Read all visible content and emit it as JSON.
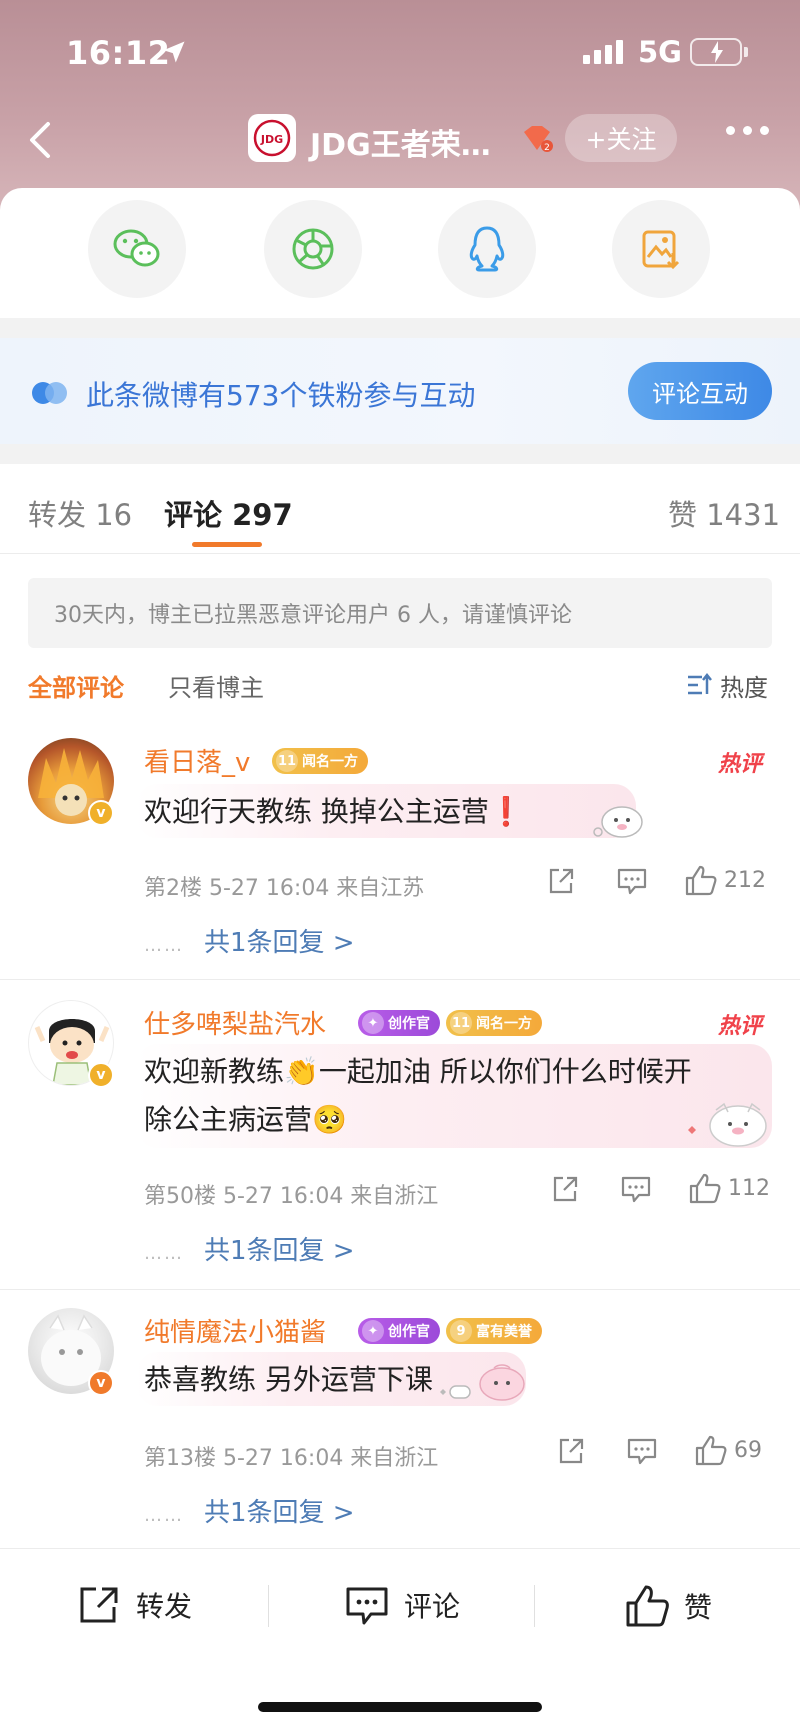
{
  "status": {
    "time": "16:12",
    "network": "5G"
  },
  "header": {
    "title": "JDG王者荣…",
    "follow_label": "+关注",
    "logo_text": "JDG"
  },
  "share_options": [
    "wechat-icon",
    "moments-icon",
    "qq-icon",
    "save-image-icon"
  ],
  "fans_banner": {
    "text": "此条微博有573个铁粉参与互动",
    "button": "评论互动"
  },
  "tabs": {
    "repost": "转发 16",
    "comment": "评论 297",
    "like": "赞 1431"
  },
  "notice": "30天内，博主已拉黑恶意评论用户 6 人，请谨慎评论",
  "filters": {
    "all": "全部评论",
    "blogger": "只看博主",
    "sort": "热度"
  },
  "comments": [
    {
      "name": "看日落_v",
      "medals": [
        {
          "num": "11",
          "label": "闻名一方"
        }
      ],
      "hot": "热评",
      "text": "欢迎行天教练 换掉公主运营❗",
      "meta": "第2楼 5-27 16:04 来自江苏",
      "likes": "212",
      "reply": "共1条回复 >"
    },
    {
      "name": "仕多啤梨盐汽水",
      "medals": [
        {
          "num": "",
          "label": "创作官"
        },
        {
          "num": "11",
          "label": "闻名一方"
        }
      ],
      "hot": "热评",
      "text_line1": "欢迎新教练👏一起加油 所以你们什么时候开",
      "text_line2": "除公主病运营🥺",
      "meta": "第50楼 5-27 16:04 来自浙江",
      "likes": "112",
      "reply": "共1条回复 >"
    },
    {
      "name": "纯情魔法小猫酱",
      "medals": [
        {
          "num": "",
          "label": "创作官"
        },
        {
          "num": "9",
          "label": "富有美誉"
        }
      ],
      "text": "恭喜教练 另外运营下课",
      "meta": "第13楼 5-27 16:04 来自浙江",
      "likes": "69",
      "reply": "共1条回复 >"
    }
  ],
  "reply_dots": "……",
  "bottom": {
    "repost": "转发",
    "comment": "评论",
    "like": "赞"
  },
  "colors": {
    "accent": "#f17a2b",
    "link": "#4e7cb5",
    "hot": "#f0424a"
  }
}
